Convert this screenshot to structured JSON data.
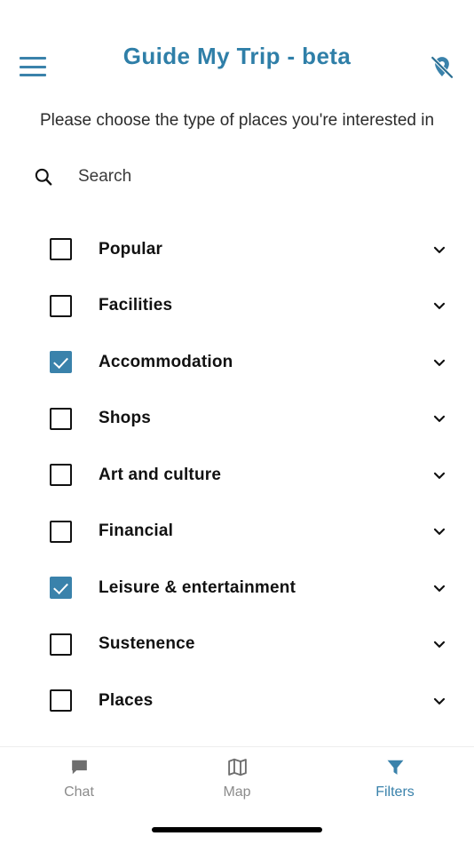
{
  "header": {
    "title": "Guide My Trip - beta",
    "menu_icon": "hamburger-menu-icon",
    "location_icon": "location-off-icon",
    "title_color": "#2f7fa8",
    "accent_color": "#3a82ab"
  },
  "subtitle": "Please choose the type of places you're interested in",
  "search": {
    "placeholder": "Search",
    "value": "",
    "icon": "search-icon"
  },
  "categories": [
    {
      "label": "Popular",
      "checked": false,
      "expand_icon": "chevron-down-icon"
    },
    {
      "label": "Facilities",
      "checked": false,
      "expand_icon": "chevron-down-icon"
    },
    {
      "label": "Accommodation",
      "checked": true,
      "expand_icon": "chevron-down-icon"
    },
    {
      "label": "Shops",
      "checked": false,
      "expand_icon": "chevron-down-icon"
    },
    {
      "label": "Art and culture",
      "checked": false,
      "expand_icon": "chevron-down-icon"
    },
    {
      "label": "Financial",
      "checked": false,
      "expand_icon": "chevron-down-icon"
    },
    {
      "label": "Leisure & entertainment",
      "checked": true,
      "expand_icon": "chevron-down-icon"
    },
    {
      "label": "Sustenence",
      "checked": false,
      "expand_icon": "chevron-down-icon"
    },
    {
      "label": "Places",
      "checked": false,
      "expand_icon": "chevron-down-icon"
    }
  ],
  "bottom_nav": {
    "items": [
      {
        "label": "Chat",
        "icon": "chat-bubble-icon",
        "active": false
      },
      {
        "label": "Map",
        "icon": "map-icon",
        "active": false
      },
      {
        "label": "Filters",
        "icon": "filter-funnel-icon",
        "active": true
      }
    ],
    "inactive_color": "#8b8b8b",
    "active_color": "#3a82ab"
  }
}
